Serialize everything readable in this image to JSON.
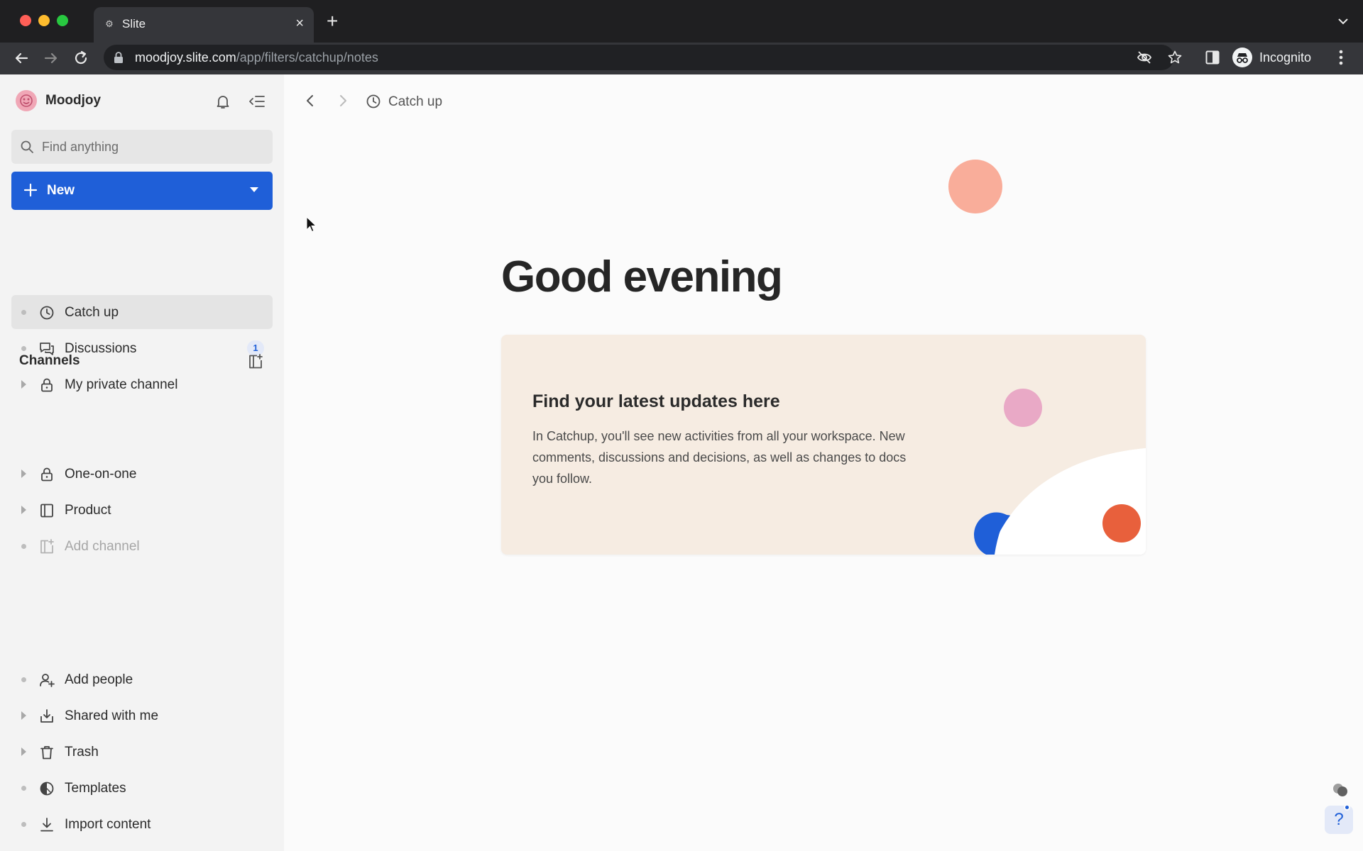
{
  "browser": {
    "tab_title": "Slite",
    "tab_close_glyph": "×",
    "new_tab_glyph": "+",
    "url_host": "moodjoy.slite.com",
    "url_path": "/app/filters/catchup/notes",
    "profile_label": "Incognito"
  },
  "sidebar": {
    "workspace_name": "Moodjoy",
    "search_placeholder": "Find anything",
    "new_button_label": "New",
    "top_items": [
      {
        "label": "Catch up",
        "icon": "clock-icon",
        "active": true
      },
      {
        "label": "Discussions",
        "icon": "discussion-icon",
        "badge": "1"
      },
      {
        "label": "My private channel",
        "icon": "lock-icon"
      }
    ],
    "channels_heading": "Channels",
    "channel_items": [
      {
        "label": "One-on-one",
        "icon": "lock-icon"
      },
      {
        "label": "Product",
        "icon": "document-icon"
      },
      {
        "label": "Add channel",
        "icon": "add-channel-icon"
      }
    ],
    "bottom_items": [
      {
        "label": "Add people",
        "icon": "add-person-icon"
      },
      {
        "label": "Shared with me",
        "icon": "inbox-icon"
      },
      {
        "label": "Trash",
        "icon": "trash-icon"
      },
      {
        "label": "Templates",
        "icon": "templates-icon"
      },
      {
        "label": "Import content",
        "icon": "download-icon"
      }
    ]
  },
  "main": {
    "breadcrumb_label": "Catch up",
    "greeting": "Good evening",
    "card": {
      "title": "Find your latest updates here",
      "body": "In Catchup, you'll see new activities from all your workspace. New comments, discussions and decisions, as well as changes to docs you follow."
    },
    "help_glyph": "?"
  },
  "colors": {
    "accent": "#1f5fd8",
    "card_background": "#f6ece2",
    "deco_peach": "#f9ad9a",
    "deco_pink": "#e9a9c6",
    "deco_red": "#e8603c"
  }
}
